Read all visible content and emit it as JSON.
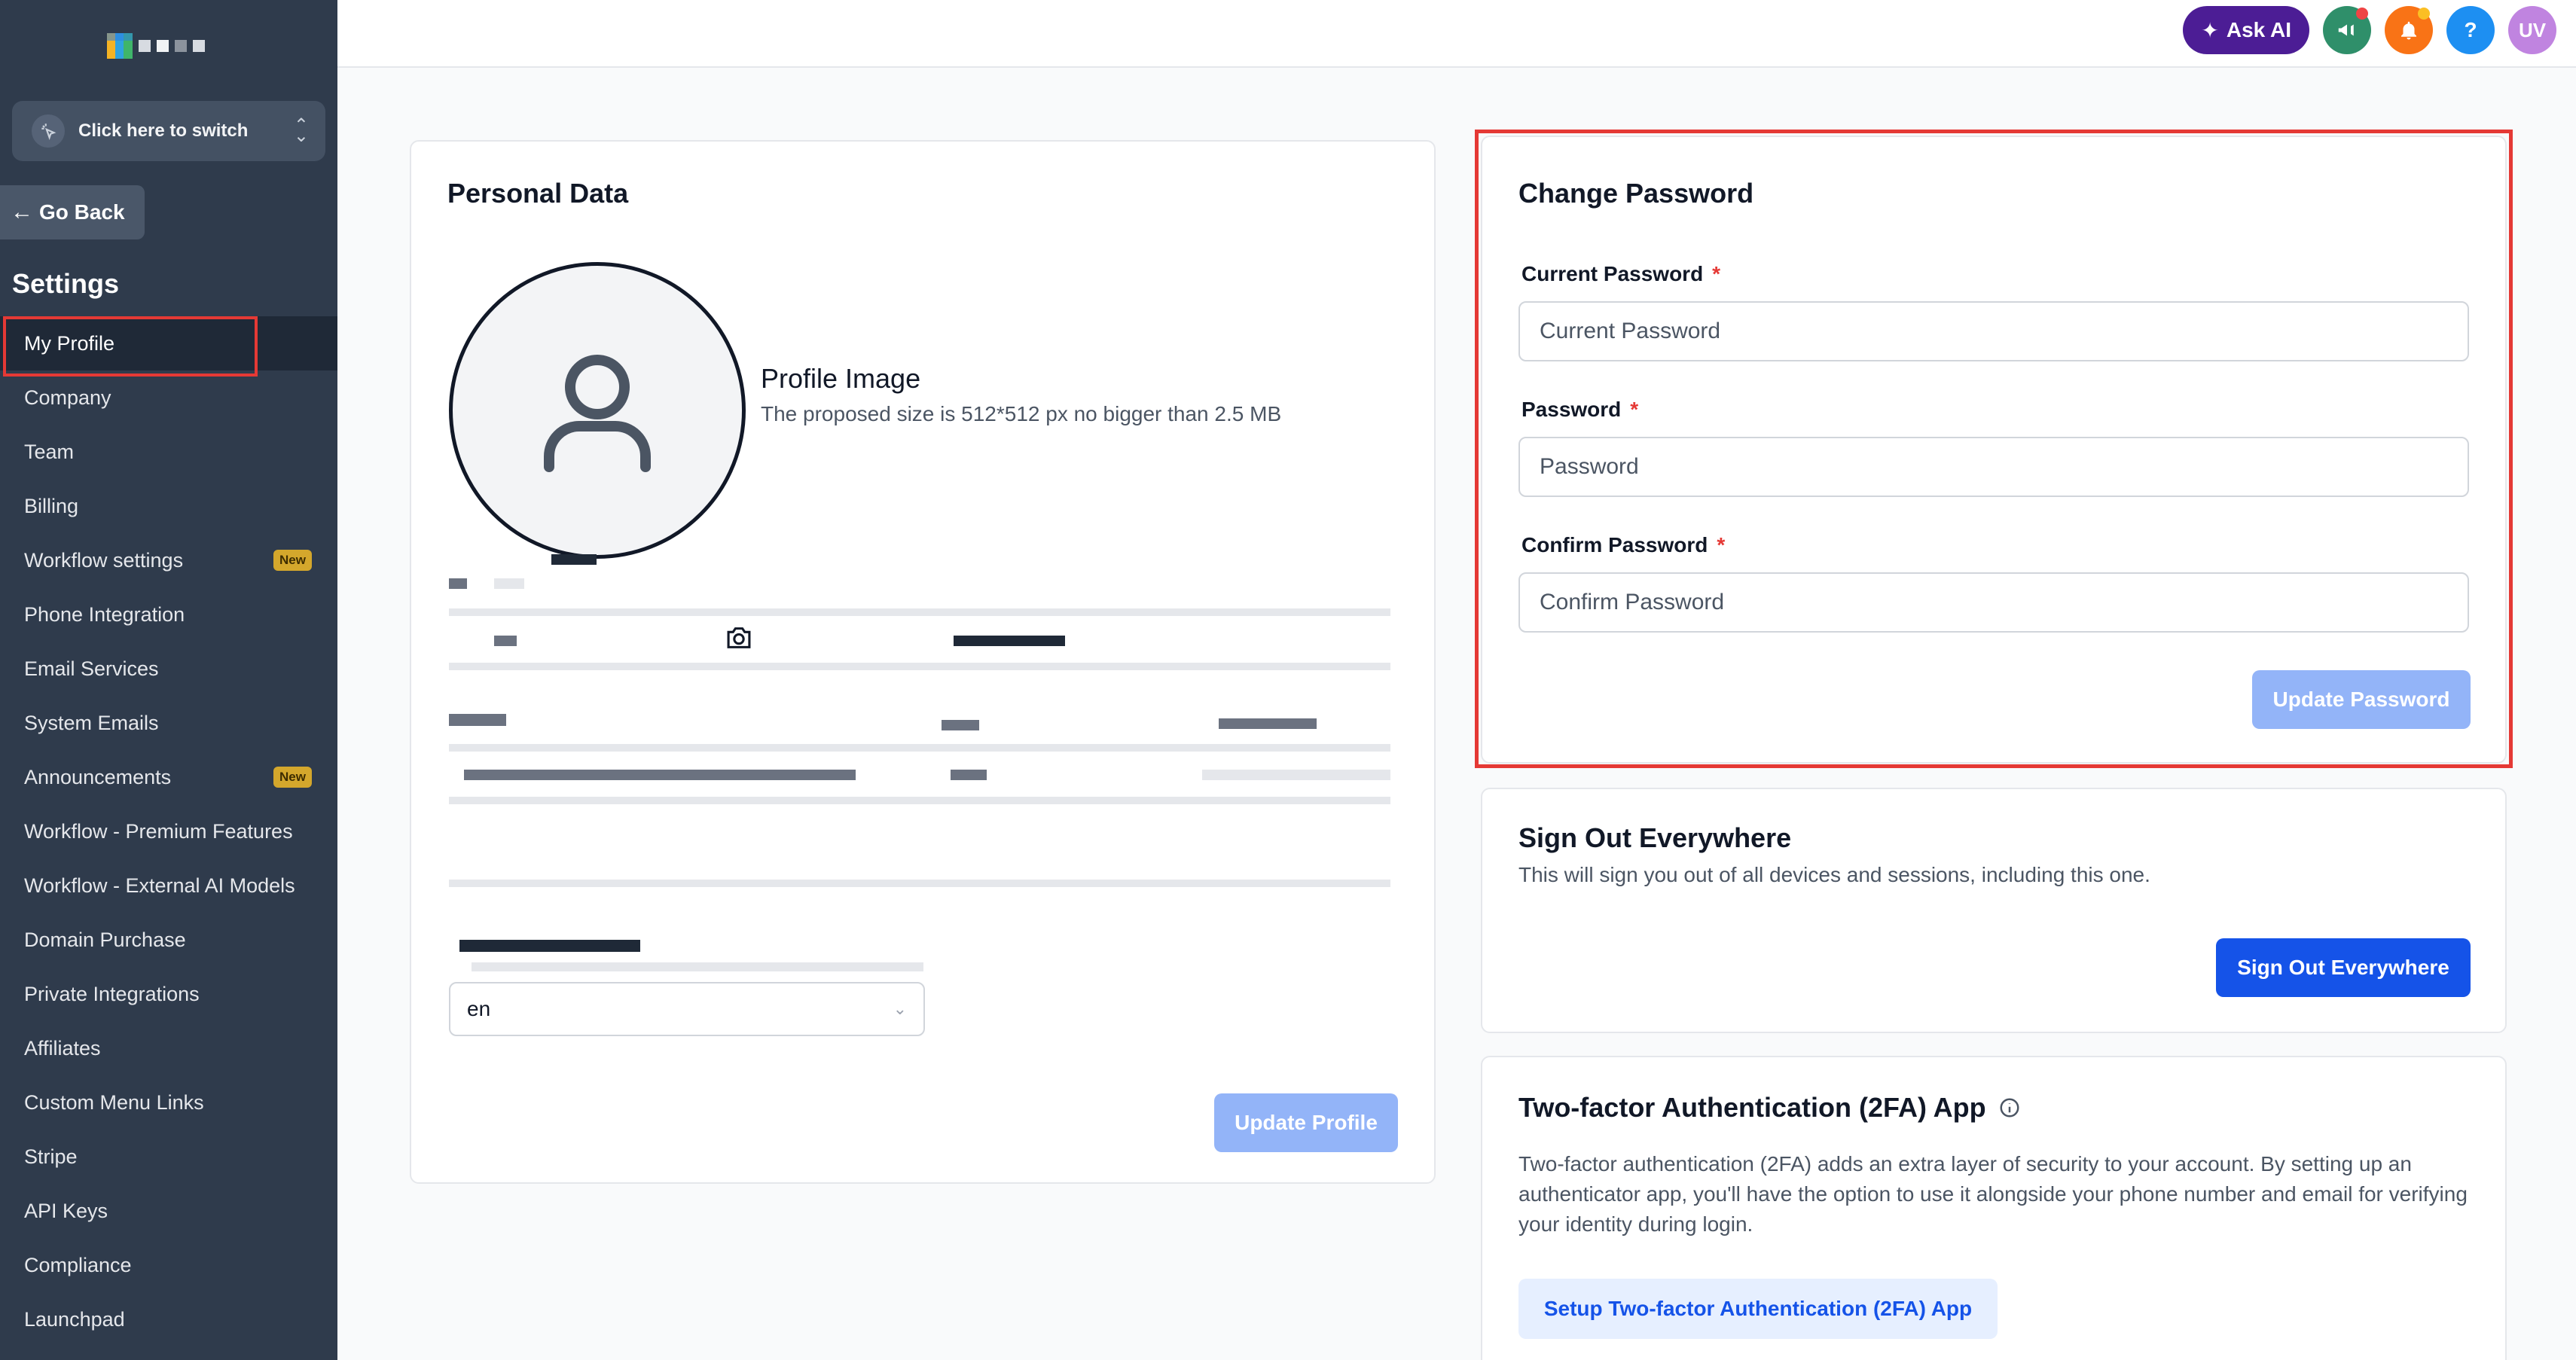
{
  "sidebar": {
    "switcher_label": "Click here to switch",
    "go_back": "Go Back",
    "settings_title": "Settings",
    "items": [
      {
        "label": "My Profile",
        "active": true,
        "badge": ""
      },
      {
        "label": "Company",
        "badge": ""
      },
      {
        "label": "Team",
        "badge": ""
      },
      {
        "label": "Billing",
        "badge": ""
      },
      {
        "label": "Workflow settings",
        "badge": "New"
      },
      {
        "label": "Phone Integration",
        "badge": ""
      },
      {
        "label": "Email Services",
        "badge": ""
      },
      {
        "label": "System Emails",
        "badge": ""
      },
      {
        "label": "Announcements",
        "badge": "New"
      },
      {
        "label": "Workflow - Premium Features",
        "badge": ""
      },
      {
        "label": "Workflow - External AI Models",
        "badge": ""
      },
      {
        "label": "Domain Purchase",
        "badge": ""
      },
      {
        "label": "Private Integrations",
        "badge": ""
      },
      {
        "label": "Affiliates",
        "badge": ""
      },
      {
        "label": "Custom Menu Links",
        "badge": ""
      },
      {
        "label": "Stripe",
        "badge": ""
      },
      {
        "label": "API Keys",
        "badge": ""
      },
      {
        "label": "Compliance",
        "badge": ""
      },
      {
        "label": "Launchpad",
        "badge": ""
      }
    ]
  },
  "topbar": {
    "ask_ai": "Ask AI",
    "help": "?",
    "avatar_initials": "UV"
  },
  "personal_data": {
    "title": "Personal Data",
    "profile_image_title": "Profile Image",
    "profile_image_hint": "The proposed size is 512*512 px no bigger than 2.5 MB",
    "language_value": "en",
    "update_button": "Update Profile"
  },
  "change_password": {
    "title": "Change Password",
    "current_label": "Current Password",
    "current_placeholder": "Current Password",
    "password_label": "Password",
    "password_placeholder": "Password",
    "confirm_label": "Confirm Password",
    "confirm_placeholder": "Confirm Password",
    "required_mark": "*",
    "update_button": "Update Password"
  },
  "sign_out": {
    "title": "Sign Out Everywhere",
    "description": "This will sign you out of all devices and sessions, including this one.",
    "button": "Sign Out Everywhere"
  },
  "two_factor": {
    "title": "Two-factor Authentication (2FA) App",
    "description": "Two-factor authentication (2FA) adds an extra layer of security to your account. By setting up an authenticator app, you'll have the option to use it alongside your phone number and email for verifying your identity during login.",
    "button": "Setup Two-factor Authentication (2FA) App"
  },
  "colors": {
    "sidebar_bg": "#2f3b4c",
    "primary": "#1553e8",
    "highlight": "#e53935",
    "badge_new": "#d4a72c"
  }
}
